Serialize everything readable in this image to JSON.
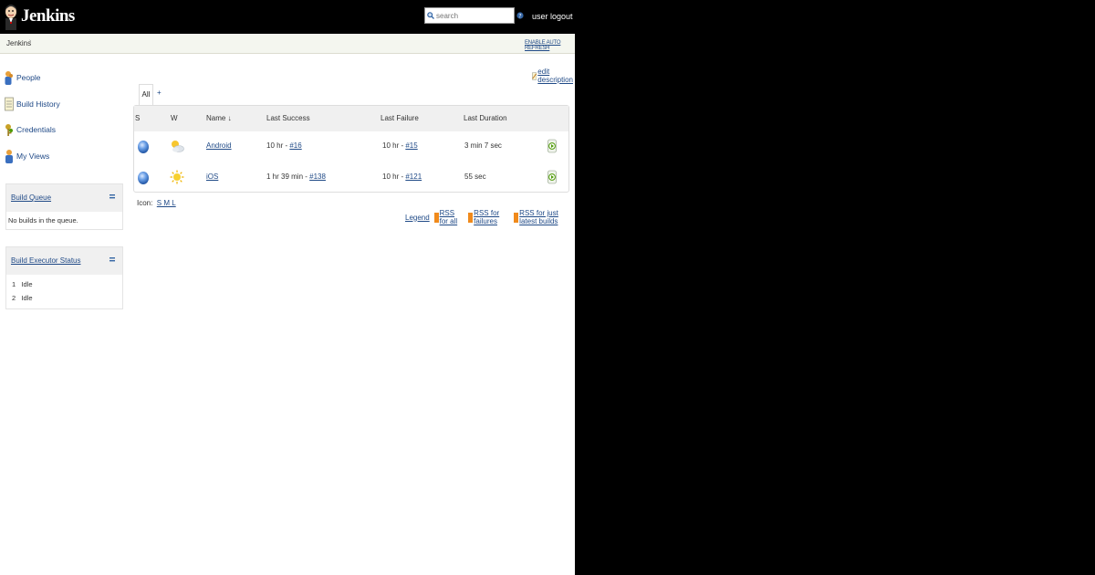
{
  "header": {
    "logo_text": "Jenkins",
    "search_placeholder": "search",
    "user_link": "user",
    "logout_link": "logout"
  },
  "breadcrumb": {
    "root": "Jenkins",
    "auto_refresh": "ENABLE AUTO REFRESH"
  },
  "sidebar": {
    "tasks": [
      {
        "label": "People",
        "icon": "people-icon"
      },
      {
        "label": "Build History",
        "icon": "notepad-icon"
      },
      {
        "label": "Credentials",
        "icon": "credentials-icon"
      },
      {
        "label": "My Views",
        "icon": "user-icon"
      }
    ],
    "build_queue": {
      "title": "Build Queue",
      "empty_text": "No builds in the queue."
    },
    "executor_status": {
      "title": "Build Executor Status",
      "executors": [
        {
          "num": "1",
          "state": "Idle"
        },
        {
          "num": "2",
          "state": "Idle"
        }
      ]
    }
  },
  "main": {
    "edit_description": "edit description",
    "tabs": {
      "active": "All",
      "add": "+"
    },
    "columns": {
      "status": "S",
      "weather": "W",
      "name": "Name ↓",
      "last_success": "Last Success",
      "last_failure": "Last Failure",
      "last_duration": "Last Duration"
    },
    "jobs": [
      {
        "name": "Android",
        "last_success_text": "10 hr - ",
        "last_success_build": "#16",
        "last_failure_text": "10 hr - ",
        "last_failure_build": "#15",
        "last_duration": "3 min 7 sec",
        "weather": "cloudy-sun-icon"
      },
      {
        "name": "iOS",
        "last_success_text": "1 hr 39 min - ",
        "last_success_build": "#138",
        "last_failure_text": "10 hr - ",
        "last_failure_build": "#121",
        "last_duration": "55 sec",
        "weather": "sunny-icon"
      }
    ],
    "icon_legend": {
      "label": "Icon:",
      "sizes": "S M L"
    },
    "footer_links": {
      "legend": "Legend",
      "rss_all": "RSS for all",
      "rss_failures": "RSS for failures",
      "rss_latest": "RSS for just latest builds"
    }
  },
  "colors": {
    "header_bg": "#000000",
    "link": "#204a87",
    "breadcrumb_bg": "#f4f6ef"
  }
}
